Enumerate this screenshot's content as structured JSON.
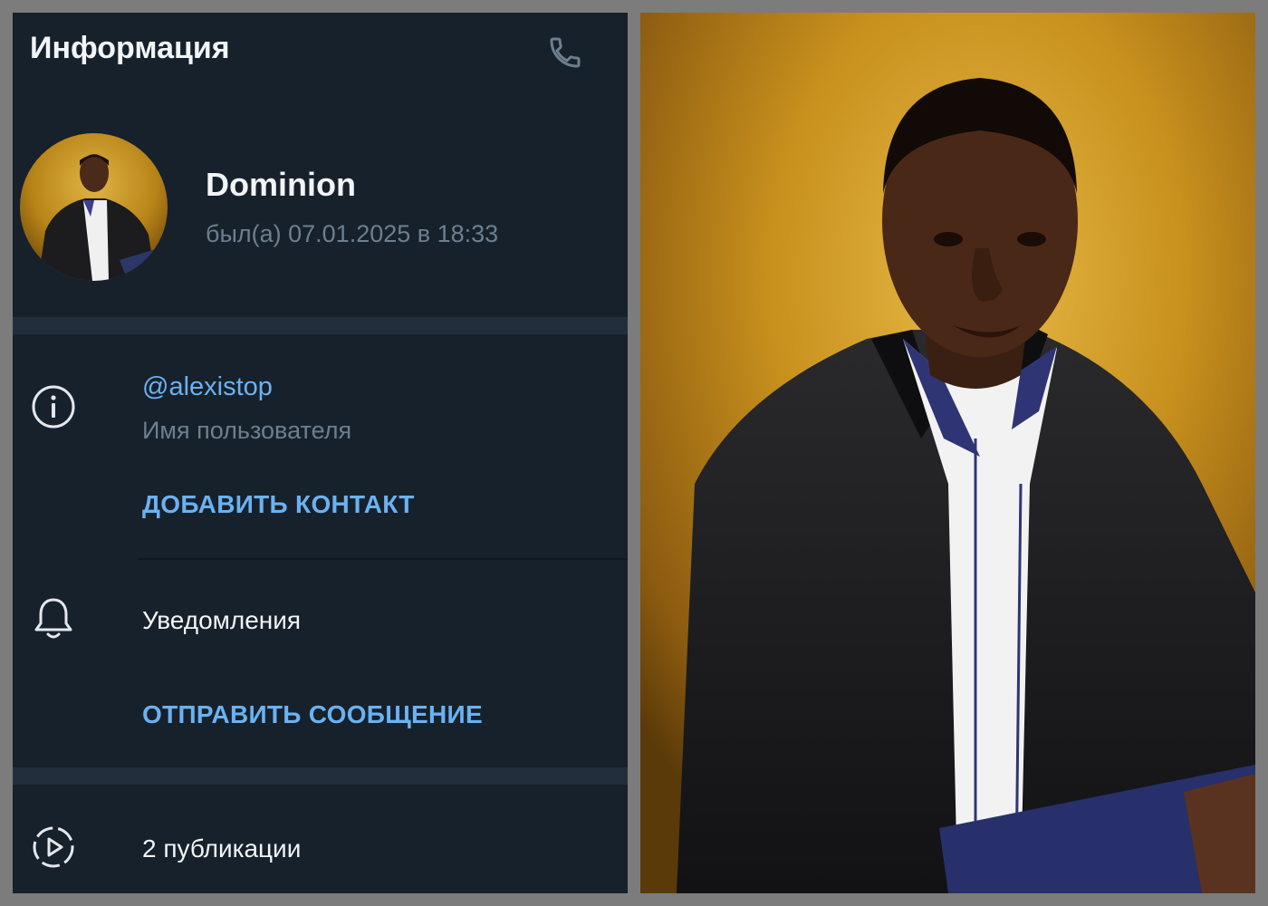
{
  "header": {
    "title": "Информация",
    "call_icon": "phone-icon"
  },
  "profile": {
    "name": "Dominion",
    "last_seen": "был(а) 07.01.2025 в 18:33",
    "avatar_icon": "avatar"
  },
  "info": {
    "icon": "info-icon",
    "username": "@alexistop",
    "username_caption": "Имя пользователя",
    "add_contact_label": "ДОБАВИТЬ КОНТАКТ"
  },
  "notifications": {
    "icon": "bell-icon",
    "label": "Уведомления",
    "send_message_label": "ОТПРАВИТЬ СООБЩЕНИЕ"
  },
  "stories": {
    "icon": "stories-play-icon",
    "label": "2 публикации"
  },
  "colors": {
    "panel_bg": "#17212b",
    "section_gap": "#232e3c",
    "accent": "#6ab2f2",
    "muted_text": "#6d7f8f",
    "primary_text": "#f2f5f8",
    "photo_bg": "#c8901d"
  }
}
